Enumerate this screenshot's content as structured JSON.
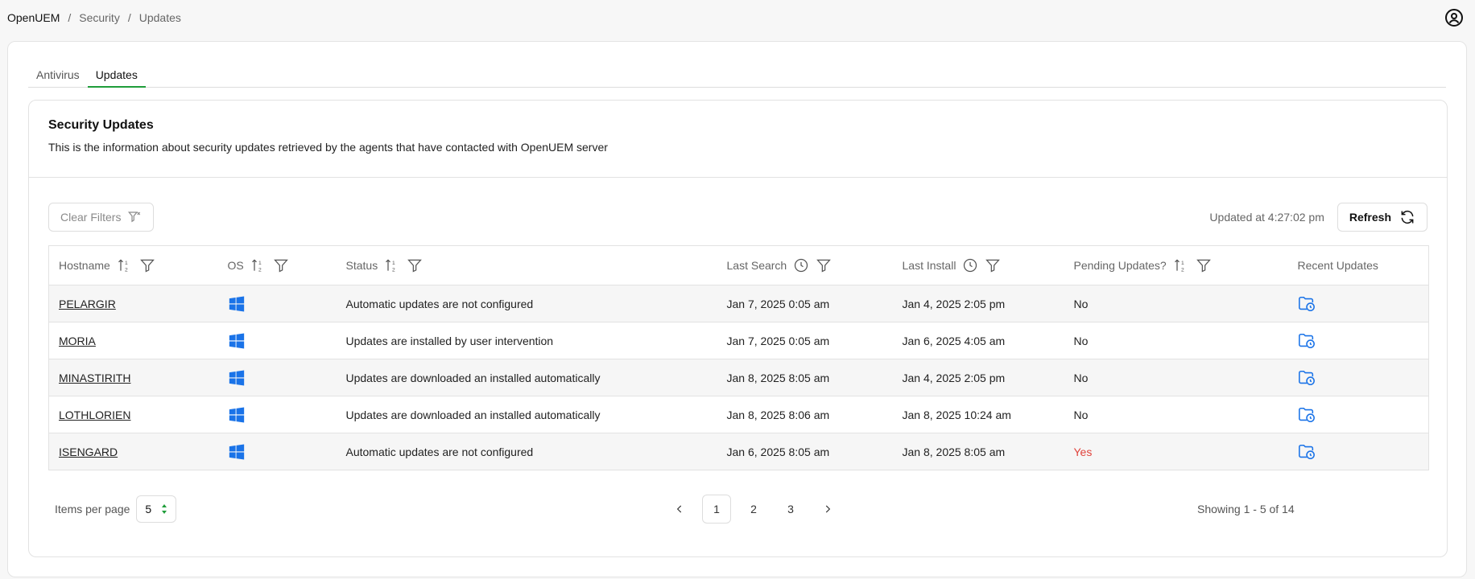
{
  "breadcrumb": {
    "root": "OpenUEM",
    "section": "Security",
    "page": "Updates",
    "sep": "/"
  },
  "tabs": [
    {
      "label": "Antivirus",
      "active": false
    },
    {
      "label": "Updates",
      "active": true
    }
  ],
  "card": {
    "title": "Security Updates",
    "description": "This is the information about security updates retrieved by the agents that have contacted with OpenUEM server"
  },
  "toolbar": {
    "clear_filters": "Clear Filters",
    "updated_at": "Updated at 4:27:02 pm",
    "refresh": "Refresh"
  },
  "table": {
    "headers": {
      "hostname": "Hostname",
      "os": "OS",
      "status": "Status",
      "last_search": "Last Search",
      "last_install": "Last Install",
      "pending": "Pending Updates?",
      "recent": "Recent Updates"
    },
    "rows": [
      {
        "hostname": "PELARGIR",
        "os_icon": "windows-icon",
        "status": "Automatic updates are not configured",
        "last_search": "Jan 7, 2025 0:05 am",
        "last_install": "Jan 4, 2025 2:05 pm",
        "pending": "No"
      },
      {
        "hostname": "MORIA",
        "os_icon": "windows-icon",
        "status": "Updates are installed by user intervention",
        "last_search": "Jan 7, 2025 0:05 am",
        "last_install": "Jan 6, 2025 4:05 am",
        "pending": "No"
      },
      {
        "hostname": "MINASTIRITH",
        "os_icon": "windows-icon",
        "status": "Updates are downloaded an installed automatically",
        "last_search": "Jan 8, 2025 8:05 am",
        "last_install": "Jan 4, 2025 2:05 pm",
        "pending": "No"
      },
      {
        "hostname": "LOTHLORIEN",
        "os_icon": "windows-icon",
        "status": "Updates are downloaded an installed automatically",
        "last_search": "Jan 8, 2025 8:06 am",
        "last_install": "Jan 8, 2025 10:24 am",
        "pending": "No"
      },
      {
        "hostname": "ISENGARD",
        "os_icon": "windows-icon",
        "status": "Automatic updates are not configured",
        "last_search": "Jan 6, 2025 8:05 am",
        "last_install": "Jan 8, 2025 8:05 am",
        "pending": "Yes"
      }
    ]
  },
  "footer": {
    "items_per_page_label": "Items per page",
    "items_per_page_value": "5",
    "pages": [
      "1",
      "2",
      "3"
    ],
    "current_page": "1",
    "showing": "Showing 1 - 5 of 14"
  },
  "colors": {
    "accent_green": "#1f9d3a",
    "windows_blue": "#1a73e8",
    "yes_red": "#e0433c"
  }
}
